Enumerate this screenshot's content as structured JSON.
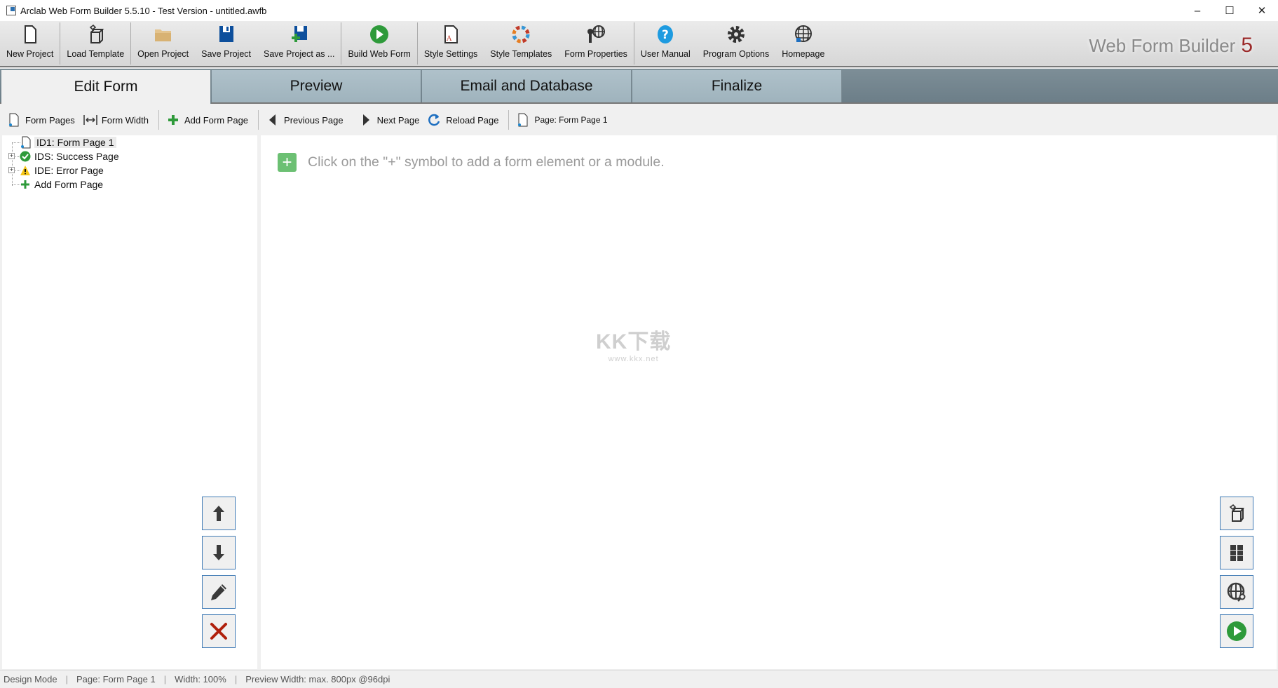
{
  "window": {
    "title": "Arclab Web Form Builder 5.5.10 - Test Version - untitled.awfb",
    "minimize": "–",
    "maximize": "☐",
    "close": "✕"
  },
  "toolbar": [
    {
      "label": "New Project",
      "icon": "new-file-icon"
    },
    {
      "label": "Load Template",
      "icon": "template-box-icon"
    },
    {
      "label": "Open Project",
      "icon": "folder-icon"
    },
    {
      "label": "Save Project",
      "icon": "floppy-icon"
    },
    {
      "label": "Save Project as ...",
      "icon": "floppy-plus-icon"
    },
    {
      "label": "Build Web Form",
      "icon": "play-icon"
    },
    {
      "label": "Style Settings",
      "icon": "style-doc-icon"
    },
    {
      "label": "Style Templates",
      "icon": "color-wheel-icon"
    },
    {
      "label": "Form Properties",
      "icon": "wrench-globe-icon"
    },
    {
      "label": "User Manual",
      "icon": "help-icon"
    },
    {
      "label": "Program Options",
      "icon": "gear-icon"
    },
    {
      "label": "Homepage",
      "icon": "globe-icon"
    }
  ],
  "brand": {
    "text": "Web Form Builder",
    "version": "5"
  },
  "tabs": [
    {
      "label": "Edit Form",
      "active": true
    },
    {
      "label": "Preview"
    },
    {
      "label": "Email and Database"
    },
    {
      "label": "Finalize"
    }
  ],
  "subtoolbar": {
    "form_pages": "Form Pages",
    "form_width": "Form Width",
    "add_form_page": "Add Form Page",
    "previous_page": "Previous Page",
    "next_page": "Next Page",
    "reload_page": "Reload Page",
    "page": "Page: Form Page 1"
  },
  "tree": [
    {
      "label": "ID1: Form Page 1",
      "selected": true
    },
    {
      "label": "IDS: Success Page"
    },
    {
      "label": "IDE: Error Page"
    },
    {
      "label": "Add Form Page"
    }
  ],
  "hint": {
    "plus": "+",
    "text": "Click on the \"+\" symbol to add a form element or a module."
  },
  "watermark": {
    "logo": "KK下载",
    "url": "www.kkx.net"
  },
  "status": {
    "mode": "Design Mode",
    "page": "Page: Form Page 1",
    "width": "Width: 100%",
    "preview": "Preview Width: max. 800px @96dpi",
    "sep": "|"
  },
  "colors": {
    "accent_green": "#2e9a3a",
    "tab_bg": "#a9bcc5",
    "brand_red": "#9b2a2a",
    "button_border": "#3f7ab5"
  }
}
